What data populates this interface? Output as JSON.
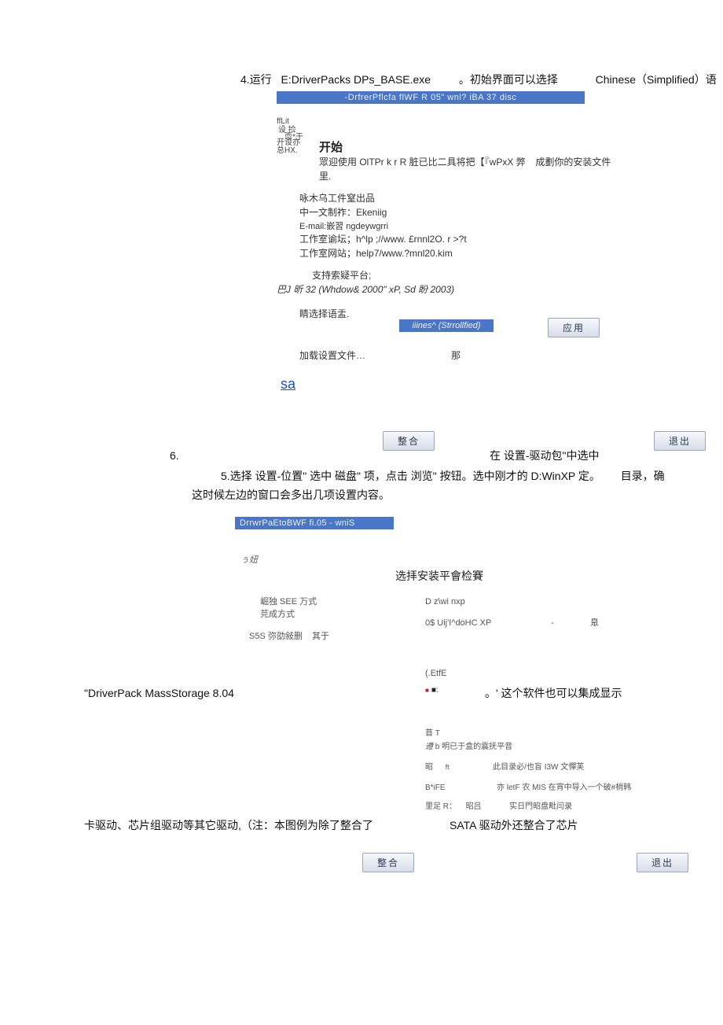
{
  "step4": {
    "prefix": "4.运行",
    "path": "E:DriverPacks DPs_BASE.exe",
    "dot": "。初始界面可以选择",
    "lang": "Chinese（Simplified）语"
  },
  "win1": {
    "title": "-DrfrerPflcfa flWF R 05\" wnl? iBA 37 disc",
    "side_ffLit": "ffLit",
    "side_sj": "设  捡",
    "side_iwy": "  恧*于",
    "side_ksy": "开设亦",
    "side_xiHX": "总HX.",
    "h_start": "开始",
    "l1a": "眾迎使用 OlTPr k r R 脏已比二具将把【『wPxX 弊",
    "l1b": "成劃你的安装文件",
    "l2": "里.",
    "l3": "咏木乌工件窒出品",
    "l4": "中一文制祚：Ekeniig",
    "l5": "E-mail:嵌習   ngdeywgrri",
    "l6": "工作室谕坛；h^lp ;//www. £rnnl2O. r >?t",
    "l7": "工作室网站；help7/www.?mnl20.kim",
    "l8": "支持索疑平台;",
    "l9": "巴J 昕 32 (Whdow& 2000\" xP, Sd 盼   2003)",
    "sel_lang": "睛选择语盂.",
    "lang_value": "iiines^ (Strrollfied)",
    "apply": "应用",
    "load_settings": "加载设置文件…",
    "na": "那",
    "sa": "sa",
    "integrate": "整合",
    "exit": "退出"
  },
  "step6": {
    "num": "6.",
    "suffix": "在  设置-驱动包\"中选中"
  },
  "step5": {
    "l1a": "5.选择 设置-位置\" 选中 磁盘\" 项，点击 浏览\" 按钮。选中刚才的 D:WinXP 定。",
    "l1b": "目录，确",
    "l2": "这时候左边的窗口会多出几项设置内容。"
  },
  "win2": {
    "title": "DrrwrPaEtoBWF fi.05 - wniS",
    "side_btn": "ぅ妞",
    "h": "选拝安装平會检賽",
    "left_l1": "崛独 SEE 万式",
    "left_l2": "芫成方式",
    "left_l3": "S5S 弥劭敍删",
    "left_l3b": "其于",
    "r_l1": "D z\\wi nxp",
    "r_l2": "0$ Uij'I^doHC XP",
    "r_l2b": "-",
    "r_l2c": "臮",
    "r_l3": "(.EtfE",
    "r_l4": "■:",
    "r_t": "苜 T",
    "r_t2a": "遵",
    "r_t2b": " b 明已于盒的震抚平音",
    "r_row1a": "昭",
    "r_row1b": "ft",
    "r_row1c": "此目录必/也盲 I3W 文憚芙",
    "r_row2a": "B*iFE",
    "r_row2b": "亦 letF 农 MIS 在宵中导入一个破#梢韩",
    "r_row3a": "里足 R：",
    "r_row3b": "昭吕",
    "r_row3c": "实日門昭盘毗闫录",
    "integrate": "整合",
    "exit": "退出"
  },
  "note1a": "\"DriverPack MassStorage 8.04",
  "note1b": "。'  这个软件也可以集成显示",
  "note2a": "卡驱动、芯片组驱动等其它驱动,（注：本图例为除了整合了",
  "note2b": "SATA 驱动外还整合了芯片"
}
